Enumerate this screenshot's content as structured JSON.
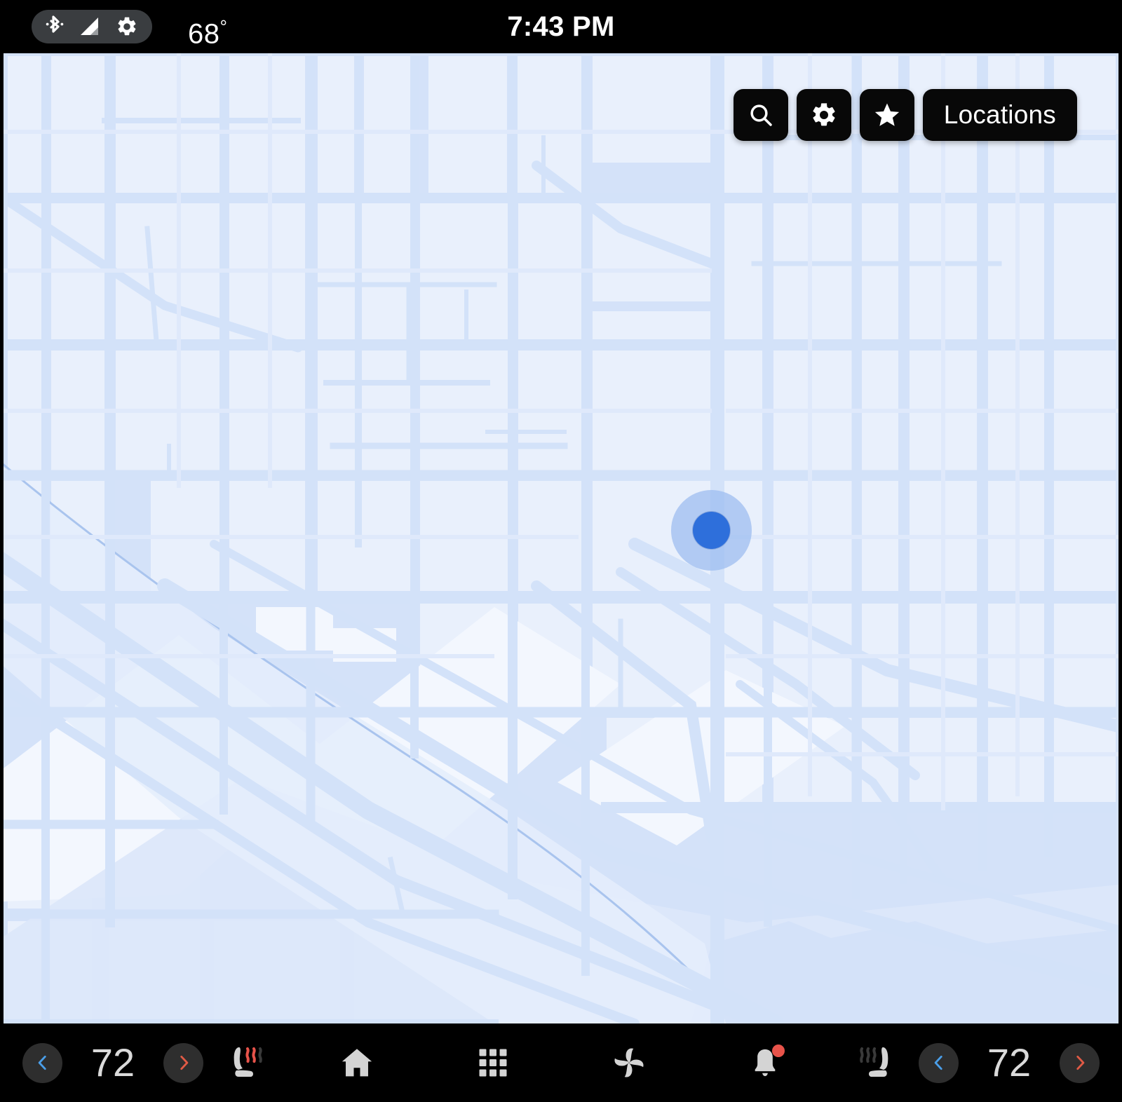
{
  "status_bar": {
    "bluetooth_icon": "bluetooth-icon",
    "signal_icon": "cellular-signal-icon",
    "settings_icon": "gear-icon",
    "outside_temp": "68",
    "degree_symbol": "°",
    "clock": "7:43 PM"
  },
  "map": {
    "background_color": "#EAF0FB",
    "road_color": "#D3E2F9",
    "water_color": "#DCE7FA",
    "block_color": "#E9F0FC",
    "marker": {
      "name": "current-location-marker",
      "dot_color": "#2E6FDB",
      "halo_color": "#9DBEF0"
    },
    "buttons": [
      {
        "name": "search-button",
        "icon": "search-icon",
        "label": ""
      },
      {
        "name": "settings-button",
        "icon": "gear-icon",
        "label": ""
      },
      {
        "name": "favorites-button",
        "icon": "star-icon",
        "label": ""
      },
      {
        "name": "locations-button",
        "icon": "",
        "label": "Locations"
      }
    ]
  },
  "bottom_bar": {
    "driver_climate": {
      "decrease_label": "chevron-left-icon",
      "temperature": "72",
      "increase_label": "chevron-right-icon",
      "seat_icon": "seat-heater-icon",
      "seat_heat_active": true
    },
    "passenger_climate": {
      "seat_icon": "seat-heater-icon",
      "seat_heat_active": false,
      "decrease_label": "chevron-left-icon",
      "temperature": "72",
      "increase_label": "chevron-right-icon"
    },
    "nav_items": [
      {
        "name": "home-button",
        "icon": "home-icon",
        "badge": false
      },
      {
        "name": "apps-button",
        "icon": "grid-icon",
        "badge": false
      },
      {
        "name": "climate-button",
        "icon": "fan-icon",
        "badge": false
      },
      {
        "name": "notifications-button",
        "icon": "bell-icon",
        "badge": true
      }
    ],
    "colors": {
      "cold_accent": "#4A9EE8",
      "hot_accent": "#E05A45",
      "badge": "#E8534A",
      "icon": "#D4D4D4",
      "circle_bg": "#2E2E2E"
    }
  }
}
